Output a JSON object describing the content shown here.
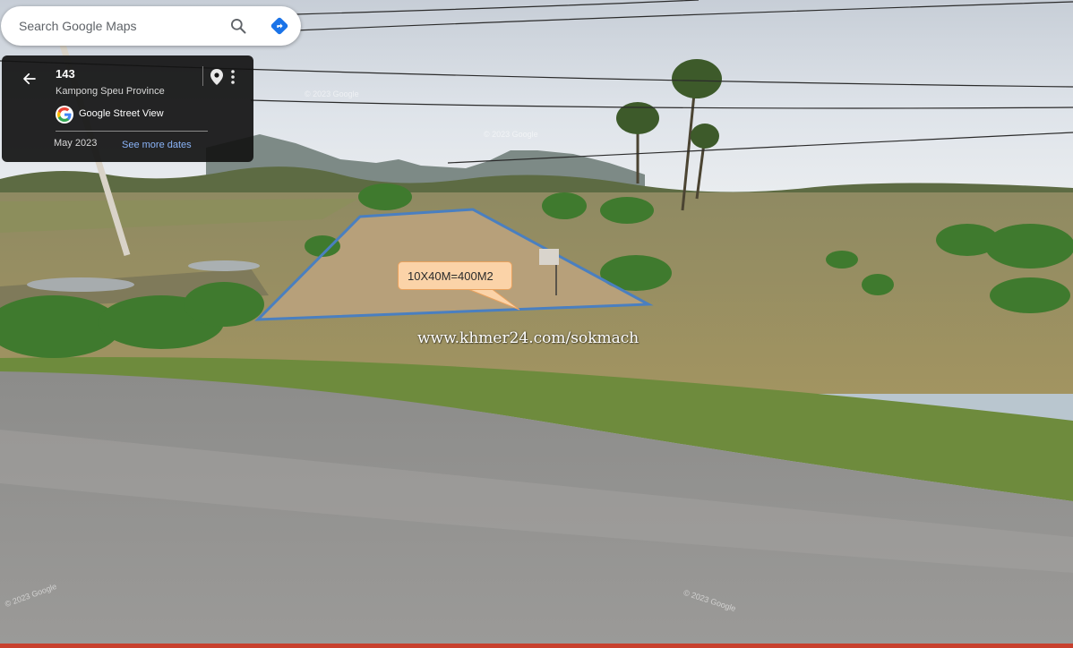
{
  "search": {
    "placeholder": "Search Google Maps",
    "search_icon": "search-icon",
    "directions_icon": "directions-icon"
  },
  "info_card": {
    "title": "143",
    "subtitle": "Kampong Speu Province",
    "source_label": "Google Street View",
    "date": "May 2023",
    "see_more": "See more dates",
    "icons": [
      "back-arrow-icon",
      "location-pin-icon",
      "more-vert-icon",
      "google-g-icon"
    ]
  },
  "annotation": {
    "callout_text": "10X40M=400M2",
    "outline_color": "#4a7fc0",
    "callout_fill": "#fbd3a8"
  },
  "watermark": {
    "text": "www.khmer24.com/sokmach"
  },
  "copyright_marks": [
    "© 2023 Google",
    "© 2023 Google",
    "© 2023 Google",
    "© 2023 Google"
  ],
  "colors": {
    "card_bg": "#121212",
    "link": "#8ab4f8",
    "directions_blue": "#1a73e8"
  }
}
